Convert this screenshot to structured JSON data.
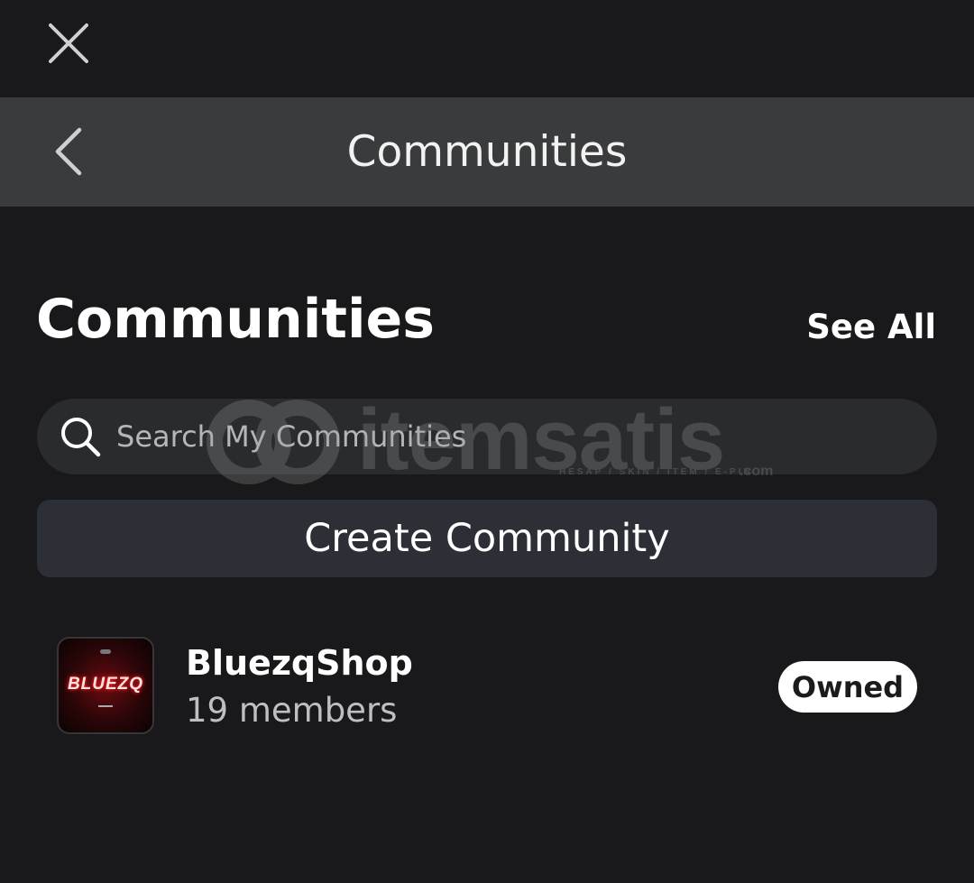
{
  "top_bar": {
    "close_icon": "close-icon"
  },
  "nav": {
    "back_icon": "chevron-left-icon",
    "title": "Communities"
  },
  "section": {
    "title": "Communities",
    "see_all_label": "See All"
  },
  "search": {
    "placeholder": "Search My Communities",
    "value": "",
    "icon": "search-icon"
  },
  "watermark": {
    "text": "itemsatis",
    "subtext": "HESAP / SKIN / ITEM / E-PIN",
    "suffix": ".com"
  },
  "create_button": {
    "label": "Create Community"
  },
  "communities": [
    {
      "name": "BluezqShop",
      "members": "19 members",
      "badge": "Owned",
      "thumbnail_text": "BLUEZQ"
    }
  ],
  "colors": {
    "background": "#19191b",
    "nav_bar": "#393b3d",
    "search_bg": "#2a2b2e",
    "button_bg": "#2d2f37",
    "badge_bg": "#ffffff",
    "thumbnail_accent": "#e01818"
  }
}
